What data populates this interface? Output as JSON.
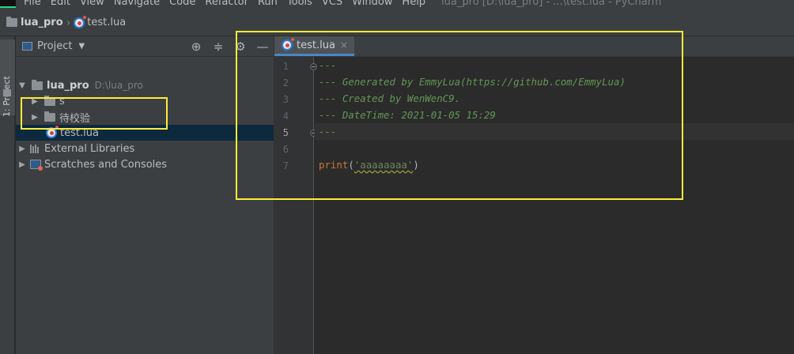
{
  "menubar": {
    "items": [
      "File",
      "Edit",
      "View",
      "Navigate",
      "Code",
      "Refactor",
      "Run",
      "Tools",
      "VCS",
      "Window",
      "Help"
    ],
    "window_title": "lua_pro [D:\\lua_pro] - ...\\test.lua - PyCharm"
  },
  "navbar": {
    "project": "lua_pro",
    "file": "test.lua"
  },
  "left_strip": {
    "tab_label": "1: Project"
  },
  "project_panel": {
    "title": "Project",
    "tools": {
      "locate_icon": "crosshair-icon",
      "collapse_icon": "collapse-icon",
      "settings_icon": "gear-icon",
      "hide_icon": "minimize-icon"
    },
    "tree": {
      "root_label": "lua_pro",
      "root_path": "D:\\lua_pro",
      "folder_s": "s",
      "folder_pending": "待校验",
      "file_test": "test.lua",
      "external_libraries": "External Libraries",
      "scratches": "Scratches and Consoles"
    }
  },
  "editor": {
    "tab_label": "test.lua",
    "tab_close": "×",
    "line_numbers": [
      "1",
      "2",
      "3",
      "4",
      "5",
      "6",
      "7"
    ],
    "active_line": "5",
    "lines": {
      "l1": "---",
      "l2": "--- Generated by EmmyLua(https://github.com/EmmyLua)",
      "l3": "--- Created by WenWenC9.",
      "l4": "--- DateTime: 2021-01-05 15:29",
      "l5": "---",
      "l7_fn": "print",
      "l7_open": "(",
      "l7_str": "'aaaaaaaa'",
      "l7_close": ")"
    }
  },
  "colors": {
    "highlight_box": "#ffeb3b",
    "selection": "#0d293e",
    "comment": "#629755",
    "keyword": "#cc7832",
    "string": "#6a8759"
  }
}
